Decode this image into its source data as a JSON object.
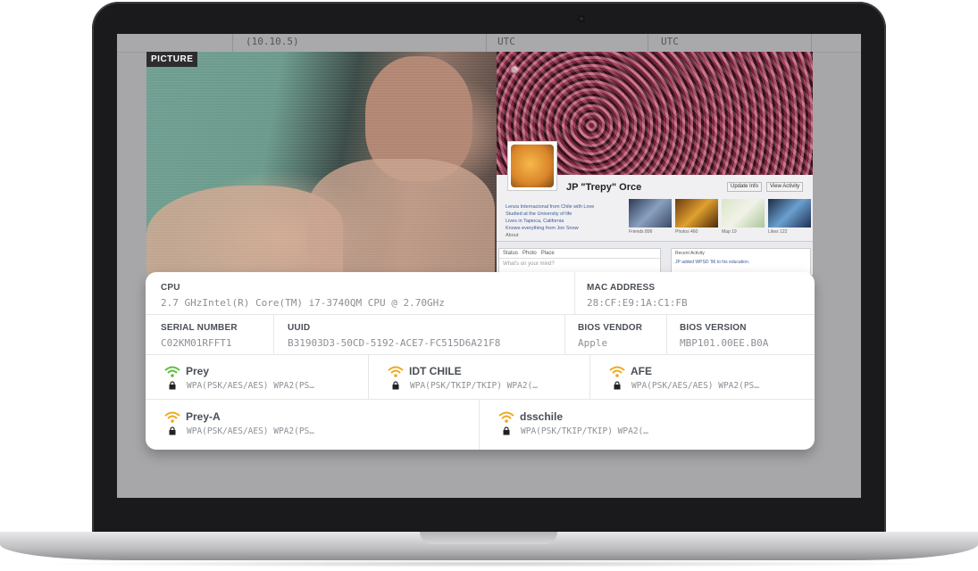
{
  "background_table": {
    "os_version": "(10.10.5)",
    "timezone_1": "UTC",
    "timezone_2": "UTC"
  },
  "picture": {
    "label": "PICTURE"
  },
  "facebook_screenshot": {
    "profile_name": "JP \"Trepy\" Orce",
    "update_info_button": "Update Info",
    "view_activity_button": "View Activity",
    "info_lines": [
      "Lenza Internacional from Chile with Love",
      "Studied at the University of life",
      "Lives in Tapioca, California",
      "Knows everything from Jon Snow"
    ],
    "about_link": "About",
    "thumbs": [
      "Friends 896",
      "Photos 460",
      "Map 19",
      "Likes 122"
    ],
    "status_tabs": [
      "Status",
      "Photo",
      "Place"
    ],
    "status_placeholder": "What's on your mind?",
    "recent_activity_title": "Recent Activity",
    "recent_activity_text": "JP added WPSD '96 to his education."
  },
  "device_info": {
    "cpu": {
      "label": "CPU",
      "value": "2.7 GHzIntel(R) Core(TM) i7-3740QM CPU @ 2.70GHz"
    },
    "mac_address": {
      "label": "MAC ADDRESS",
      "value": "28:CF:E9:1A:C1:FB"
    },
    "serial_number": {
      "label": "SERIAL NUMBER",
      "value": "C02KM01RFFT1"
    },
    "uuid": {
      "label": "UUID",
      "value": "B31903D3-50CD-5192-ACE7-FC515D6A21F8"
    },
    "bios_vendor": {
      "label": "BIOS VENDOR",
      "value": "Apple"
    },
    "bios_version": {
      "label": "BIOS VERSION",
      "value": "MBP101.00EE.B0A"
    }
  },
  "networks": [
    {
      "ssid": "Prey",
      "security": "WPA(PSK/AES/AES) WPA2(PS…",
      "signal_color": "#5cbf3a"
    },
    {
      "ssid": "IDT CHILE",
      "security": "WPA(PSK/TKIP/TKIP) WPA2(…",
      "signal_color": "#f0a81e"
    },
    {
      "ssid": "AFE",
      "security": "WPA(PSK/AES/AES) WPA2(PS…",
      "signal_color": "#f0a81e"
    },
    {
      "ssid": "Prey-A",
      "security": "WPA(PSK/AES/AES) WPA2(PS…",
      "signal_color": "#f0a81e"
    },
    {
      "ssid": "dsschile",
      "security": "WPA(PSK/TKIP/TKIP) WPA2(…",
      "signal_color": "#f0a81e"
    }
  ],
  "icons": {
    "wifi": "wifi-icon",
    "lock": "lock-icon",
    "camera": "camera-icon"
  }
}
